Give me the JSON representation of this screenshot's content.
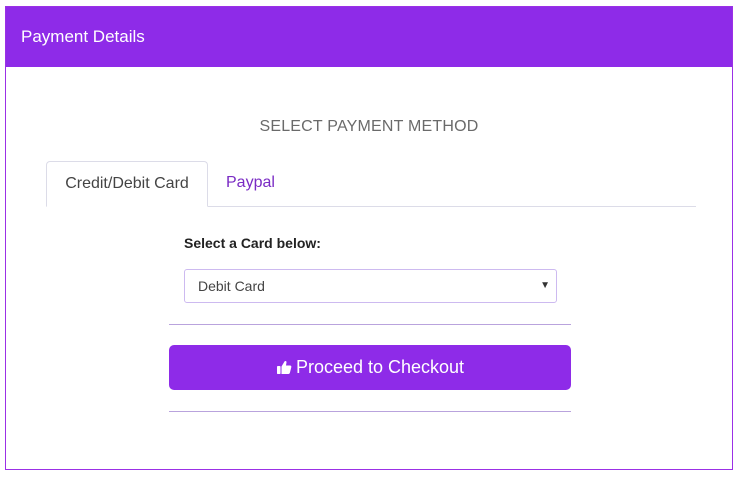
{
  "header": {
    "title": "Payment Details"
  },
  "main": {
    "section_title": "SELECT PAYMENT METHOD",
    "tabs": [
      {
        "label": "Credit/Debit Card",
        "active": true
      },
      {
        "label": "Paypal",
        "active": false
      }
    ],
    "card_select": {
      "label": "Select a Card below:",
      "selected": "Debit Card"
    },
    "checkout": {
      "label": "Proceed to Checkout",
      "icon": "thumbs-up-icon"
    }
  },
  "colors": {
    "accent": "#8e2be8",
    "tab_inactive_text": "#7a2bc4"
  }
}
